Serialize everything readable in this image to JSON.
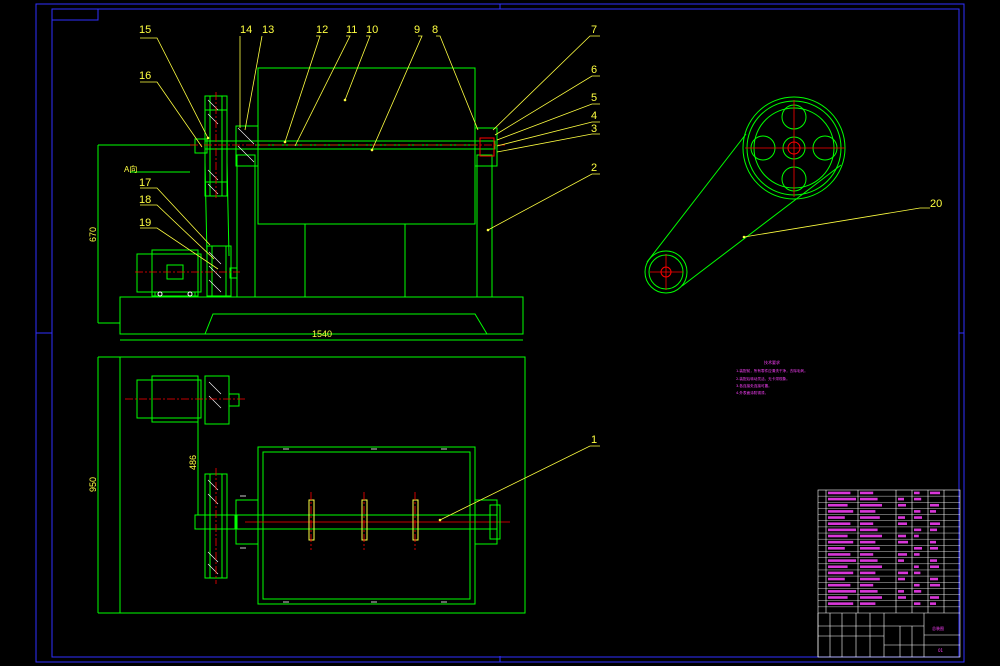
{
  "callouts": [
    {
      "label": "15"
    },
    {
      "label": "14"
    },
    {
      "label": "13"
    },
    {
      "label": "12"
    },
    {
      "label": "11"
    },
    {
      "label": "10"
    },
    {
      "label": "9"
    },
    {
      "label": "8"
    },
    {
      "label": "7"
    },
    {
      "label": "6"
    },
    {
      "label": "5"
    },
    {
      "label": "4"
    },
    {
      "label": "3"
    },
    {
      "label": "2"
    },
    {
      "label": "16"
    },
    {
      "label": "17"
    },
    {
      "label": "18"
    },
    {
      "label": "19"
    },
    {
      "label": "1"
    },
    {
      "label": "20"
    }
  ],
  "dimensions": {
    "height_front": "670",
    "width_front": "1540",
    "height_plan": "950",
    "motor_offset": "486"
  },
  "section_label": "A向",
  "tech_notes": {
    "title": "技术要求",
    "lines": [
      "1.装配前，所有零件应清洗干净，去除毛刺。",
      "2.装配后转动灵活，无卡滞现象。",
      "3.各连接处连接可靠。",
      "4.外表面涂防锈漆。"
    ]
  },
  "title_block": {
    "name": "总装图",
    "sheet": "01"
  },
  "colors": {
    "background": "#000000",
    "outline": "#00ff00",
    "frame": "#3030ff",
    "leader": "#ffff40",
    "center": "#ff0000",
    "annotation": "#ff40ff",
    "white": "#ffffff"
  }
}
